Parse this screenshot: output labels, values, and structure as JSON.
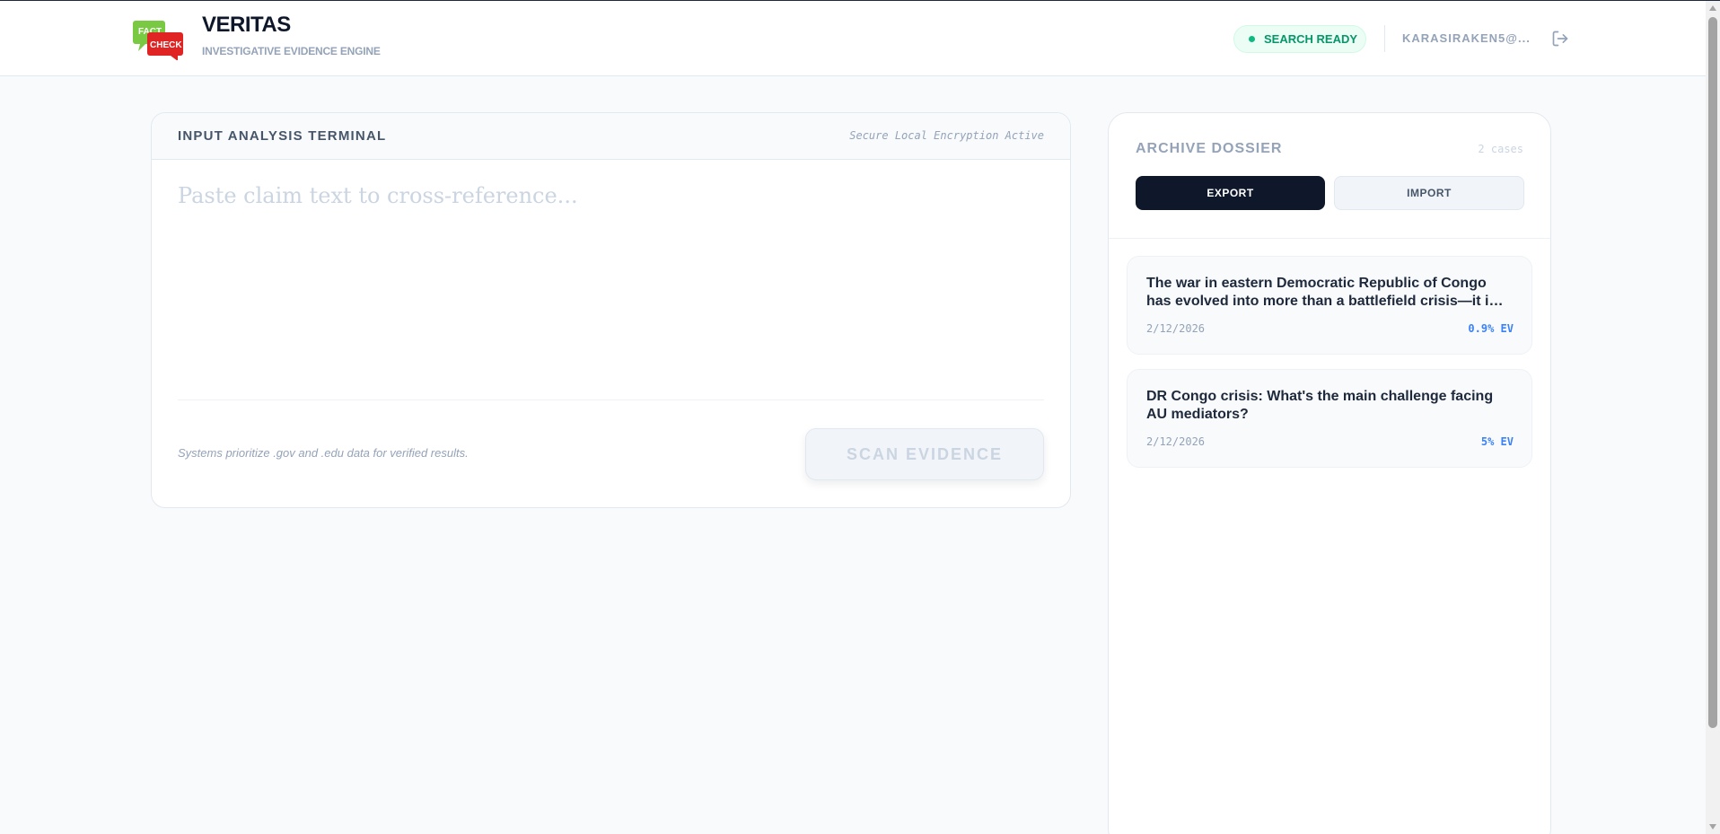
{
  "header": {
    "brand_title": "VERITAS",
    "brand_subtitle": "INVESTIGATIVE EVIDENCE ENGINE",
    "logo": {
      "text_top": "FACT",
      "text_bottom": "CHECK",
      "color_green": "#7ac943",
      "color_red": "#e02424"
    },
    "status": "SEARCH READY",
    "user_email": "KARASIRAKEN5@...",
    "logout_icon": "logout-icon"
  },
  "input_panel": {
    "title": "INPUT ANALYSIS TERMINAL",
    "encryption_note": "Secure Local Encryption Active",
    "placeholder": "Paste claim text to cross-reference...",
    "hint": "Systems prioritize .gov and .edu data for verified results.",
    "scan_label": "SCAN EVIDENCE"
  },
  "archive": {
    "title": "ARCHIVE DOSSIER",
    "count": "2 cases",
    "export_label": "EXPORT",
    "import_label": "IMPORT",
    "cases": [
      {
        "title": "The war in eastern Democratic Republic of Congo has evolved into more than a battlefield crisis—it is now a complex diplomatic struggle",
        "date": "2/12/2026",
        "ev": "0.9% EV"
      },
      {
        "title": "DR Congo crisis: What's the main challenge facing AU mediators?",
        "date": "2/12/2026",
        "ev": "5% EV"
      }
    ]
  },
  "colors": {
    "accent_dark": "#0f172a",
    "status_green": "#059669",
    "ev_blue": "#3b82f6"
  }
}
